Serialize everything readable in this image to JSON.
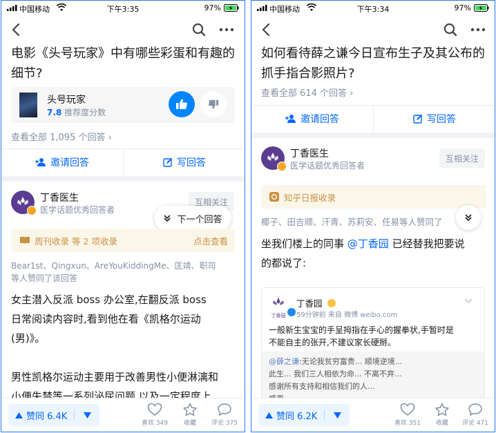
{
  "status": {
    "left": {
      "carrier": "中国移动",
      "time": "下午3:35",
      "battery": "97%"
    },
    "right": {
      "carrier": "中国移动",
      "time": "下午3:34",
      "battery": "97%"
    }
  },
  "left": {
    "question_title": "电影《头号玩家》中有哪些彩蛋和有趣的细节?",
    "movie": {
      "name": "头号玩家",
      "score": "7.8",
      "score_label": "推荐度分数"
    },
    "view_all": "查看全部 1,095 个回答 ›",
    "actions": {
      "invite": "邀请回答",
      "write": "写回答"
    },
    "answer": {
      "author": "丁香医生",
      "author_desc": "医学话题优秀回答者",
      "follow": "互相关注",
      "next_answer": "下一个回答",
      "collect_text": "周刊收录 等 2 项收录",
      "collect_link": "点击查看",
      "voters_line1": "Bear1st、Qingxun、AreYouKiddingMe、匡靖、职司",
      "voters_line2": "等人赞同了该回答",
      "para1_line1": "女主潜入反派 boss 办公室,在翻反派 boss",
      "para1_line2": "日常阅读内容时,看到他在看《凯格尔运动",
      "para1_line3": "(男)》。",
      "para2_line1": "男性凯格尔运动主要用于改善男性小便淋漓和",
      "para2_line2": "小便失禁等一系列泌尿问题,以及一定程度上"
    },
    "bottom": {
      "vote": "赞同 6.4K",
      "like": "喜欢 349",
      "collect": "收藏",
      "comment": "评论 375"
    }
  },
  "right": {
    "question_title": "如何看待薛之谦今日宣布生子及其公布的抓手指合影照片?",
    "view_all": "查看全部 614 个回答 ›",
    "actions": {
      "invite": "邀请回答",
      "write": "写回答"
    },
    "answer": {
      "author": "丁香医生",
      "author_desc": "医学话题优秀回答者",
      "follow": "互相关注",
      "collect_text": "知乎日报收录",
      "voters": "椰子、田吉顺、汗青、苏莉安、任易等人赞同了",
      "body_line1_pre": "坐我们楼上的同事 ",
      "body_mention": "@丁香园",
      "body_line1_post": " 已经替我把要说",
      "body_line2": "的都说了:"
    },
    "weibo": {
      "logo_text": "丁香园",
      "author": "丁香园",
      "meta": "59分钟前  来自 微博 weibo.com",
      "text_line1": "一般新生宝宝的手呈拇指在手心的握拳状,手暂时是",
      "text_line2": "不能自主的张开,不建议家长硬掰。",
      "quote_mention": "@薛之谦",
      "quote_line1": ":无论我贫穷富贵... 顺境逆境...",
      "quote_line2": "此生... 我们三人相依为命... 不离不弃...",
      "quote_line3": "感谢所有支持和相信我们的人...",
      "quote_line4": "感恩..."
    },
    "bottom": {
      "vote": "赞同 6.2K",
      "like": "喜欢 351",
      "collect": "收藏",
      "comment": "评论 471"
    }
  },
  "colors": {
    "brand_blue": "#0066ff",
    "muted": "#8590a6",
    "collect_gold": "#c99241",
    "avatar_purple": "#5a3d91"
  }
}
